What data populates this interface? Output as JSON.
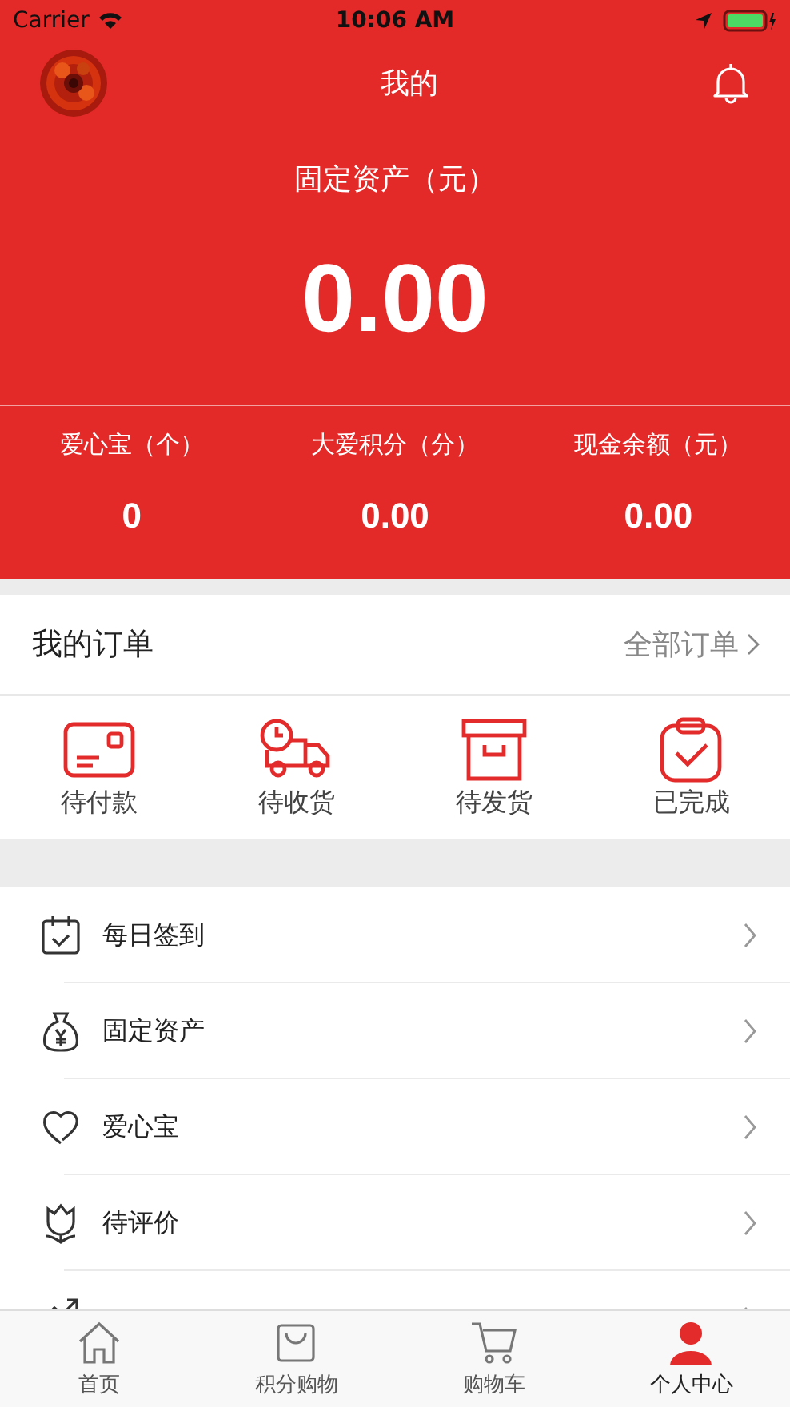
{
  "status_bar": {
    "carrier": "Carrier",
    "time": "10:06 AM"
  },
  "header": {
    "title": "我的"
  },
  "assets": {
    "label": "固定资产（元）",
    "value": "0.00"
  },
  "stats": [
    {
      "label": "爱心宝（个）",
      "value": "0"
    },
    {
      "label": "大爱积分（分）",
      "value": "0.00"
    },
    {
      "label": "现金余额（元）",
      "value": "0.00"
    }
  ],
  "orders": {
    "title": "我的订单",
    "link": "全部订单",
    "items": [
      {
        "kind": "card",
        "label": "待付款"
      },
      {
        "kind": "truck",
        "label": "待收货"
      },
      {
        "kind": "box",
        "label": "待发货"
      },
      {
        "kind": "clipboard",
        "label": "已完成"
      }
    ]
  },
  "menu": [
    {
      "kind": "calendar",
      "label": "每日签到"
    },
    {
      "kind": "moneybag",
      "label": "固定资产"
    },
    {
      "kind": "heart",
      "label": "爱心宝"
    },
    {
      "kind": "flower",
      "label": "待评价"
    },
    {
      "kind": "chart"
    }
  ],
  "tab_bar": [
    {
      "kind": "home",
      "label": "首页",
      "selected": false
    },
    {
      "kind": "bag",
      "label": "积分购物",
      "selected": false
    },
    {
      "kind": "cart",
      "label": "购物车",
      "selected": false
    },
    {
      "kind": "person",
      "label": "个人中心",
      "selected": true
    }
  ]
}
